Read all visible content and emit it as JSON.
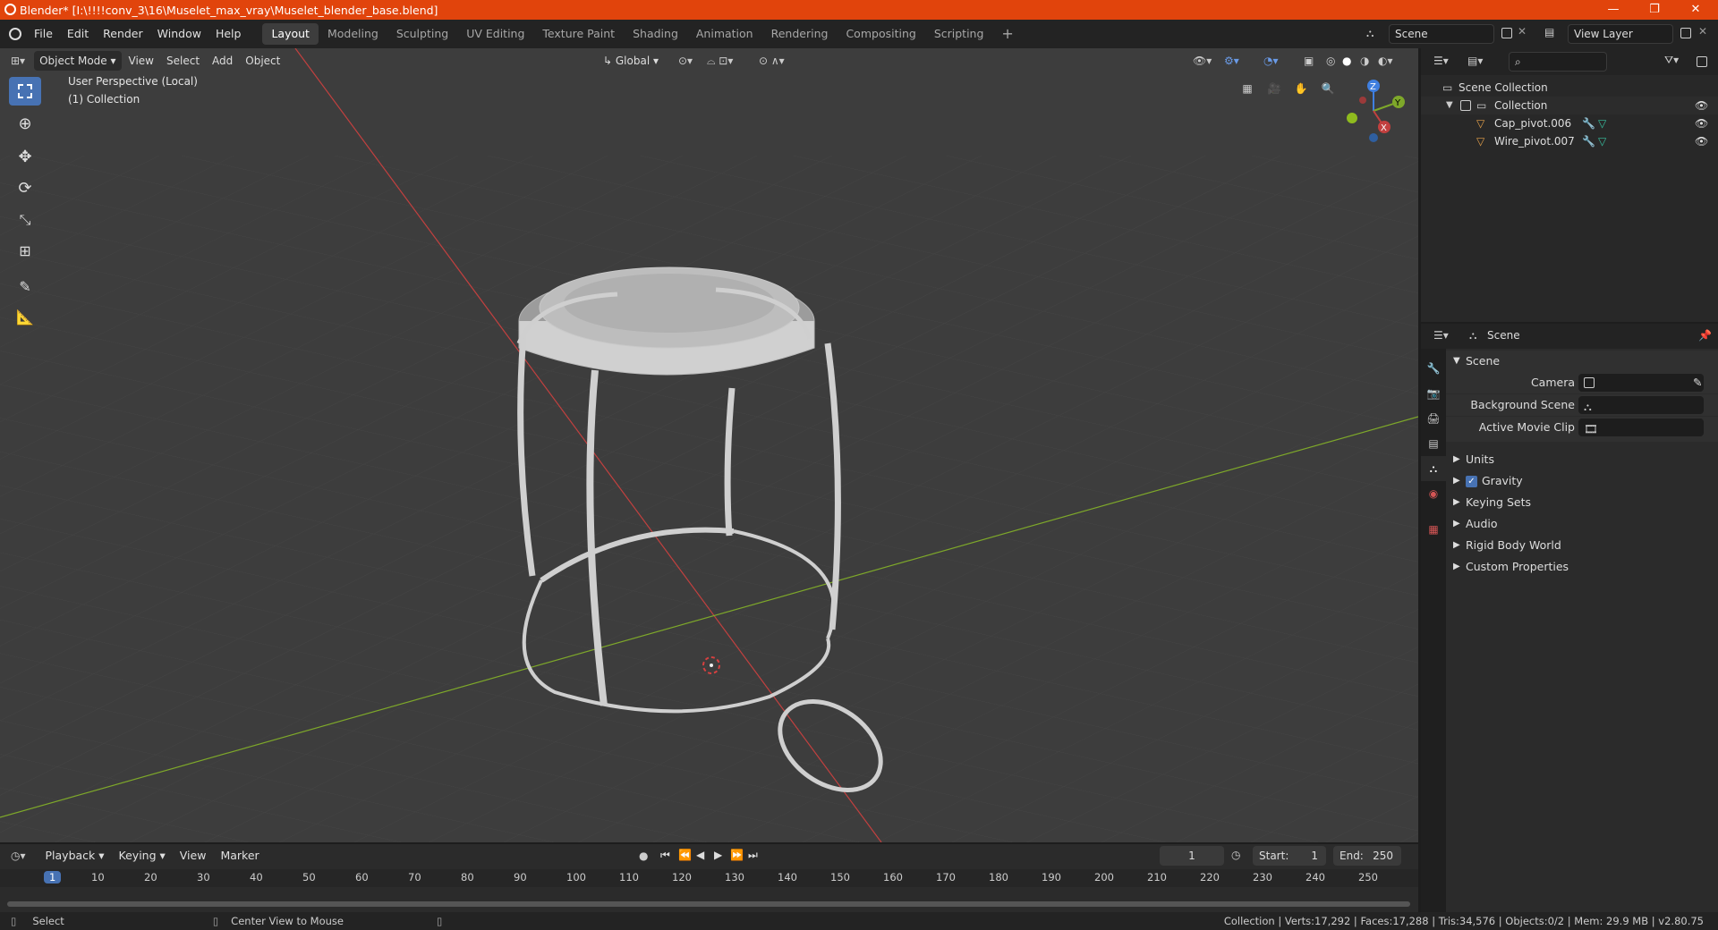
{
  "titlebar": {
    "text": "Blender* [I:\\!!!!conv_3\\16\\Muselet_max_vray\\Muselet_blender_base.blend]"
  },
  "menus": [
    "File",
    "Edit",
    "Render",
    "Window",
    "Help"
  ],
  "workspaces": [
    "Layout",
    "Modeling",
    "Sculpting",
    "UV Editing",
    "Texture Paint",
    "Shading",
    "Animation",
    "Rendering",
    "Compositing",
    "Scripting"
  ],
  "scene_field": "Scene",
  "view_layer_field": "View Layer",
  "viewport_header": {
    "mode": "Object Mode",
    "view": "View",
    "select": "Select",
    "add": "Add",
    "object": "Object",
    "orientation": "Global"
  },
  "viewport": {
    "perspective": "User Perspective (Local)",
    "collection": "(1) Collection"
  },
  "outliner": {
    "root": "Scene Collection",
    "collection": "Collection",
    "objects": [
      "Cap_pivot.006",
      "Wire_pivot.007"
    ]
  },
  "properties": {
    "header": "Scene",
    "panel": "Scene",
    "camera_label": "Camera",
    "bg_scene_label": "Background Scene",
    "movie_clip_label": "Active Movie Clip",
    "sections": [
      "Units",
      "Gravity",
      "Keying Sets",
      "Audio",
      "Rigid Body World",
      "Custom Properties"
    ]
  },
  "timeline": {
    "playback": "Playback",
    "keying": "Keying",
    "view": "View",
    "marker": "Marker",
    "current_frame": "1",
    "start_label": "Start:",
    "start": "1",
    "end_label": "End:",
    "end": "250",
    "ruler": [
      "1",
      "10",
      "20",
      "30",
      "40",
      "50",
      "60",
      "70",
      "80",
      "90",
      "100",
      "110",
      "120",
      "130",
      "140",
      "150",
      "160",
      "170",
      "180",
      "190",
      "200",
      "210",
      "220",
      "230",
      "240",
      "250"
    ]
  },
  "statusbar": {
    "select": "Select",
    "center_view": "Center View to Mouse",
    "stats": "Collection | Verts:17,292 | Faces:17,288 | Tris:34,576 | Objects:0/2 | Mem: 29.9 MB | v2.80.75"
  },
  "colors": {
    "titlebar": "#e1440c",
    "active_tool": "#4772b3",
    "x_axis": "#c2403f",
    "y_axis": "#7ea82a",
    "z_axis": "#3f7fe0"
  }
}
